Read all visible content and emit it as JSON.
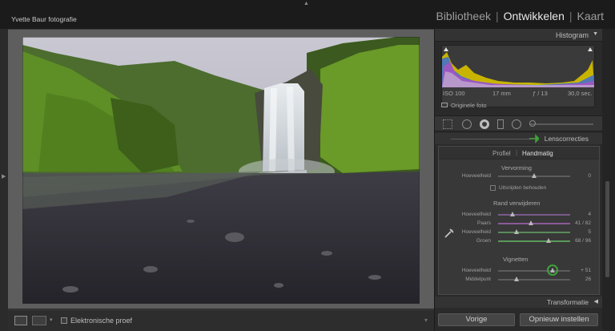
{
  "header": {
    "studio_name": "Yvette Baur fotografie",
    "modules": [
      {
        "label": "Bibliotheek",
        "active": false
      },
      {
        "label": "Ontwikkelen",
        "active": true
      },
      {
        "label": "Kaart",
        "active": false
      }
    ]
  },
  "toolbar": {
    "proof_label": "Elektronische proef"
  },
  "histogram": {
    "title": "Histogram",
    "iso": "ISO 100",
    "focal_length": "17 mm",
    "aperture": "ƒ / 13",
    "shutter": "30,0 sec.",
    "original_label": "Originele foto"
  },
  "lens": {
    "title": "Lenscorrecties",
    "tabs": [
      "Profiel",
      "Handmatig"
    ],
    "active_tab": "Handmatig",
    "distortion": {
      "title": "Vervorming",
      "rows": [
        {
          "label": "Hoeveelheid",
          "value": "0",
          "pos": 0.5,
          "color": "#5c5c5c"
        }
      ],
      "checkbox_label": "Uitsnijden behouden"
    },
    "defringe": {
      "title": "Rand verwijderen",
      "rows": [
        {
          "label": "Hoeveelheid",
          "value": "4",
          "pos": 0.2,
          "color": "#7a5a8a"
        },
        {
          "label": "Paars",
          "value": "41 / 82",
          "pos": 0.45,
          "color": "#8a5a9a"
        },
        {
          "label": "Hoeveelheid",
          "value": "5",
          "pos": 0.25,
          "color": "#5a8a5a"
        },
        {
          "label": "Groen",
          "value": "68 / 96",
          "pos": 0.7,
          "color": "#5a9a5a"
        }
      ]
    },
    "vignetting": {
      "title": "Vignetten",
      "rows": [
        {
          "label": "Hoeveelheid",
          "value": "+ 51",
          "pos": 0.75,
          "color": "#5c5c5c"
        },
        {
          "label": "Middelpunt",
          "value": "26",
          "pos": 0.25,
          "color": "#5c5c5c"
        }
      ]
    }
  },
  "transform": {
    "title": "Transformatie"
  },
  "buttons": {
    "previous": "Vorige",
    "reset": "Opnieuw instellen"
  },
  "colors": {
    "accent_green": "#3fa23a",
    "panel_bg": "#2a2a2a"
  }
}
